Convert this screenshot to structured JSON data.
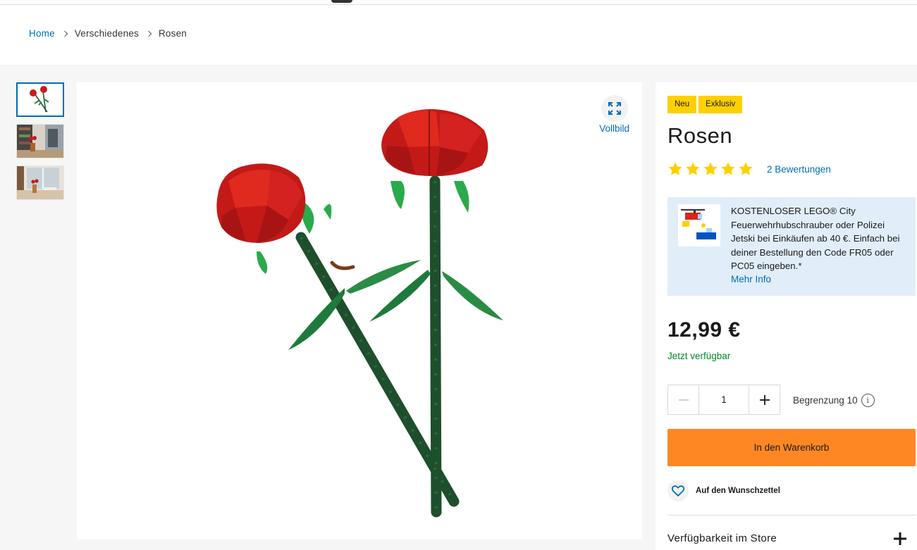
{
  "breadcrumb": {
    "home": "Home",
    "category": "Verschiedenes",
    "current": "Rosen"
  },
  "gallery": {
    "thumbnails": [
      "thumbnail-roses",
      "thumbnail-room-vase",
      "thumbnail-window-vase"
    ],
    "active_index": 0,
    "fullscreen_label": "Vollbild"
  },
  "product": {
    "badges": [
      "Neu",
      "Exklusiv"
    ],
    "title": "Rosen",
    "rating": 5,
    "reviews_label": "2 Bewertungen",
    "price": "12,99 €",
    "availability": "Jetzt verfügbar"
  },
  "promo": {
    "text": "KOSTENLOSER LEGO® City Feuerwehrhubschrauber oder Polizei Jetski bei Einkäufen ab 40 €. Einfach bei deiner Bestellung den Code FR05 oder PC05 eingeben.*",
    "more_label": "Mehr Info"
  },
  "quantity": {
    "value": "1",
    "limit_label": "Begrenzung 10",
    "info_glyph": "i"
  },
  "actions": {
    "cart_label": "In den Warenkorb",
    "wishlist_label": "Auf den Wunschzettel",
    "store_label": "Verfügbarkeit im Store"
  },
  "colors": {
    "link": "#006db7",
    "badge": "#ffcf00",
    "cart": "#ff8723",
    "available": "#00852b",
    "star": "#ffcf00",
    "promo_bg": "#e1eefa"
  },
  "icons": [
    "chevron-right-icon",
    "expand-icon",
    "star-icon",
    "minus-icon",
    "plus-icon",
    "info-icon",
    "heart-icon"
  ]
}
